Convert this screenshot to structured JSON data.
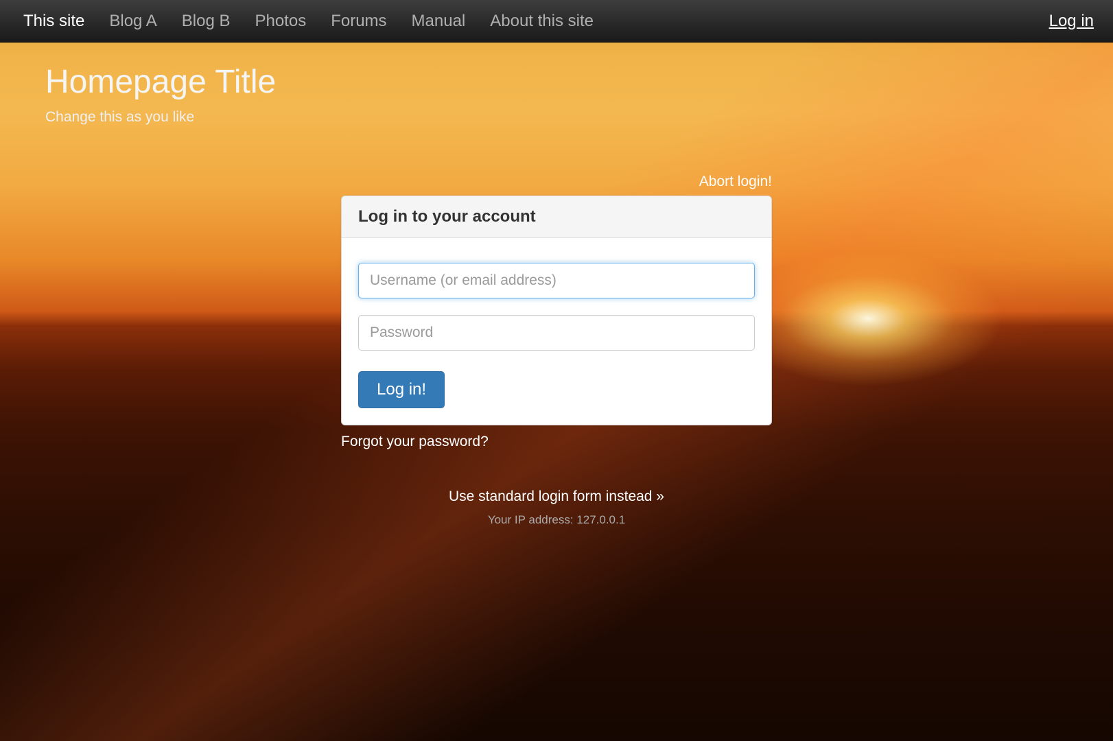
{
  "nav": {
    "items": [
      {
        "label": "This site",
        "active": true
      },
      {
        "label": "Blog A",
        "active": false
      },
      {
        "label": "Blog B",
        "active": false
      },
      {
        "label": "Photos",
        "active": false
      },
      {
        "label": "Forums",
        "active": false
      },
      {
        "label": "Manual",
        "active": false
      },
      {
        "label": "About this site",
        "active": false
      }
    ],
    "login_label": "Log in"
  },
  "hero": {
    "title": "Homepage Title",
    "subtitle": "Change this as you like"
  },
  "login": {
    "abort": "Abort login!",
    "panel_title": "Log in to your account",
    "username_placeholder": "Username (or email address)",
    "password_placeholder": "Password",
    "submit_label": "Log in!",
    "forgot": "Forgot your password?",
    "alt_form": "Use standard login form instead »",
    "ip_line": "Your IP address: 127.0.0.1"
  }
}
